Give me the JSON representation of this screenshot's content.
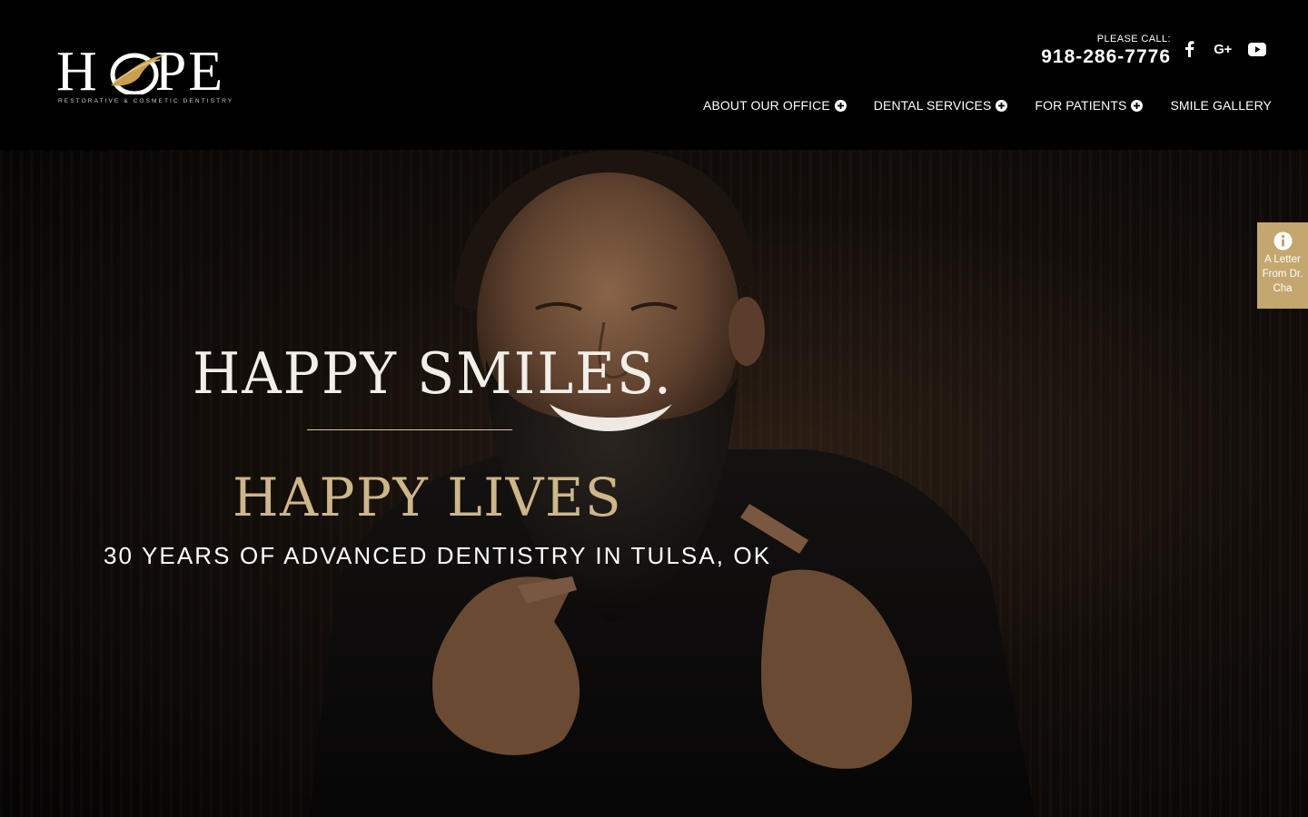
{
  "brand": {
    "logo_word_left": "H",
    "logo_word_right": "PE",
    "tagline": "RESTORATIVE & COSMETIC DENTISTRY",
    "gold": "#c9a04f"
  },
  "contact": {
    "label": "PLEASE CALL:",
    "phone": "918-286-7776"
  },
  "social": [
    {
      "name": "facebook-icon",
      "glyph": "f"
    },
    {
      "name": "google-plus-icon",
      "glyph": "G+"
    },
    {
      "name": "youtube-icon",
      "glyph": "play"
    }
  ],
  "nav": {
    "items": [
      {
        "label": "ABOUT OUR OFFICE",
        "has_submenu": true
      },
      {
        "label": "DENTAL SERVICES",
        "has_submenu": true
      },
      {
        "label": "FOR PATIENTS",
        "has_submenu": true
      },
      {
        "label": "SMILE GALLERY",
        "has_submenu": false
      }
    ]
  },
  "hero": {
    "title": "HAPPY SMILES.",
    "subtitle": "HAPPY LIVES",
    "tagline": "30 YEARS OF ADVANCED DENTISTRY IN TULSA, OK",
    "accent": "#cdb68a"
  },
  "side_tab": {
    "icon": "info-icon",
    "label": "A Letter From Dr. Cha",
    "color": "#c3a76f"
  }
}
